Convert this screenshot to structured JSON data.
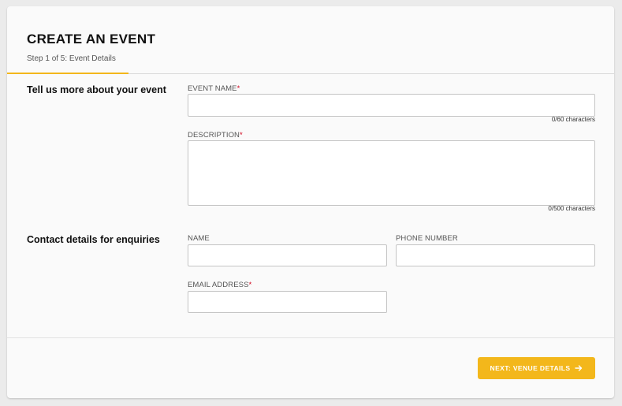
{
  "header": {
    "title": "CREATE AN EVENT",
    "step_text": "Step 1 of 5: Event Details",
    "progress_fraction": 0.2
  },
  "event_section": {
    "heading": "Tell us more about your event",
    "event_name": {
      "label": "EVENT NAME",
      "required_mark": "*",
      "value": "",
      "counter": "0/60 characters"
    },
    "description": {
      "label": "DESCRIPTION",
      "required_mark": "*",
      "value": "",
      "counter": "0/500 characters"
    }
  },
  "contact_section": {
    "heading": "Contact details for enquiries",
    "name": {
      "label": "NAME",
      "value": ""
    },
    "phone": {
      "label": "PHONE NUMBER",
      "value": ""
    },
    "email": {
      "label": "EMAIL ADDRESS",
      "required_mark": "*",
      "value": ""
    }
  },
  "footer": {
    "next_label": "NEXT: VENUE DETAILS",
    "next_icon": "arrow-right-icon"
  },
  "colors": {
    "accent": "#f3b71b",
    "required": "#d0021b",
    "background": "#ebebeb",
    "card": "#fafafa"
  }
}
